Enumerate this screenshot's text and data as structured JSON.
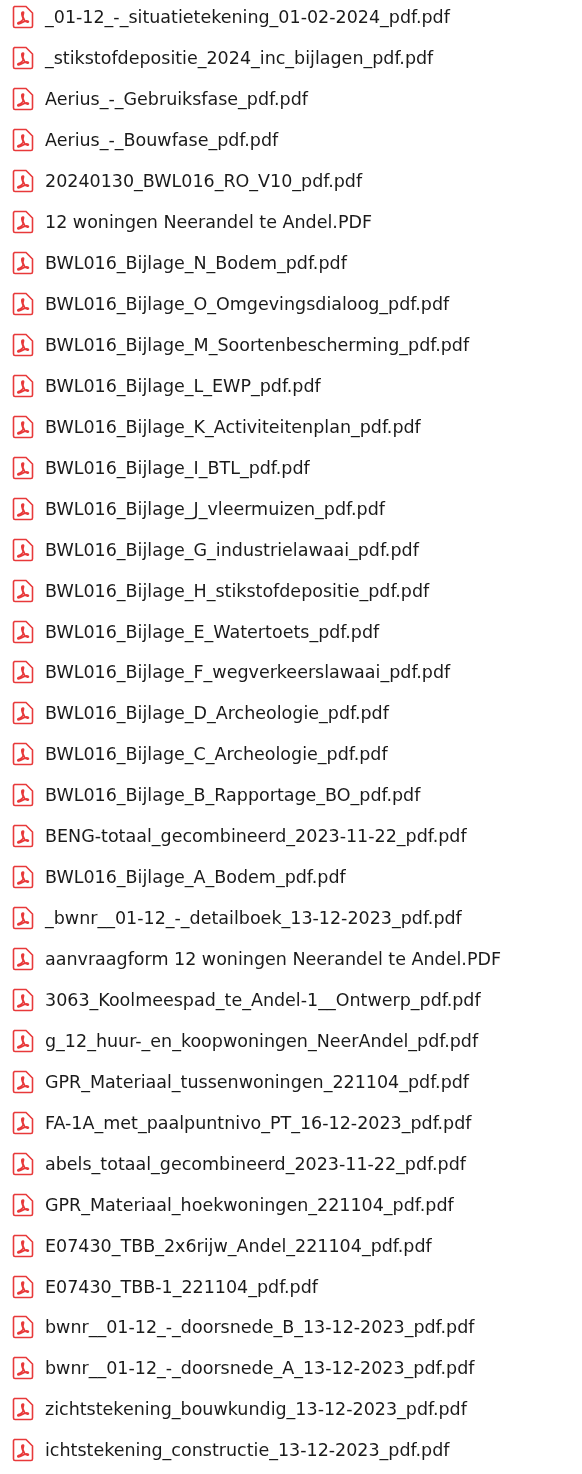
{
  "files": [
    {
      "name": "_01-12_-_situatietekening_01-02-2024_pdf.pdf"
    },
    {
      "name": "_stikstofdepositie_2024_inc_bijlagen_pdf.pdf"
    },
    {
      "name": "Aerius_-_Gebruiksfase_pdf.pdf"
    },
    {
      "name": "Aerius_-_Bouwfase_pdf.pdf"
    },
    {
      "name": "20240130_BWL016_RO_V10_pdf.pdf"
    },
    {
      "name": "12 woningen Neerandel te Andel.PDF"
    },
    {
      "name": "BWL016_Bijlage_N_Bodem_pdf.pdf"
    },
    {
      "name": "BWL016_Bijlage_O_Omgevingsdialoog_pdf.pdf"
    },
    {
      "name": "BWL016_Bijlage_M_Soortenbescherming_pdf.pdf"
    },
    {
      "name": "BWL016_Bijlage_L_EWP_pdf.pdf"
    },
    {
      "name": "BWL016_Bijlage_K_Activiteitenplan_pdf.pdf"
    },
    {
      "name": "BWL016_Bijlage_I_BTL_pdf.pdf"
    },
    {
      "name": "BWL016_Bijlage_J_vleermuizen_pdf.pdf"
    },
    {
      "name": "BWL016_Bijlage_G_industrielawaai_pdf.pdf"
    },
    {
      "name": "BWL016_Bijlage_H_stikstofdepositie_pdf.pdf"
    },
    {
      "name": "BWL016_Bijlage_E_Watertoets_pdf.pdf"
    },
    {
      "name": "BWL016_Bijlage_F_wegverkeerslawaai_pdf.pdf"
    },
    {
      "name": "BWL016_Bijlage_D_Archeologie_pdf.pdf"
    },
    {
      "name": "BWL016_Bijlage_C_Archeologie_pdf.pdf"
    },
    {
      "name": "BWL016_Bijlage_B_Rapportage_BO_pdf.pdf"
    },
    {
      "name": "BENG-totaal_gecombineerd_2023-11-22_pdf.pdf"
    },
    {
      "name": "BWL016_Bijlage_A_Bodem_pdf.pdf"
    },
    {
      "name": "_bwnr__01-12_-_detailboek_13-12-2023_pdf.pdf"
    },
    {
      "name": "aanvraagform 12 woningen Neerandel te Andel.PDF"
    },
    {
      "name": "3063_Koolmeespad_te_Andel-1__Ontwerp_pdf.pdf"
    },
    {
      "name": "g_12_huur-_en_koopwoningen_NeerAndel_pdf.pdf"
    },
    {
      "name": "GPR_Materiaal_tussenwoningen_221104_pdf.pdf"
    },
    {
      "name": "FA-1A_met_paalpuntnivo_PT_16-12-2023_pdf.pdf"
    },
    {
      "name": "abels_totaal_gecombineerd_2023-11-22_pdf.pdf"
    },
    {
      "name": "GPR_Materiaal_hoekwoningen_221104_pdf.pdf"
    },
    {
      "name": "E07430_TBB_2x6rijw_Andel_221104_pdf.pdf"
    },
    {
      "name": "E07430_TBB-1_221104_pdf.pdf"
    },
    {
      "name": "bwnr__01-12_-_doorsnede_B_13-12-2023_pdf.pdf"
    },
    {
      "name": "bwnr__01-12_-_doorsnede_A_13-12-2023_pdf.pdf"
    },
    {
      "name": "zichtstekening_bouwkundig_13-12-2023_pdf.pdf"
    },
    {
      "name": "ichtstekening_constructie_13-12-2023_pdf.pdf"
    }
  ]
}
